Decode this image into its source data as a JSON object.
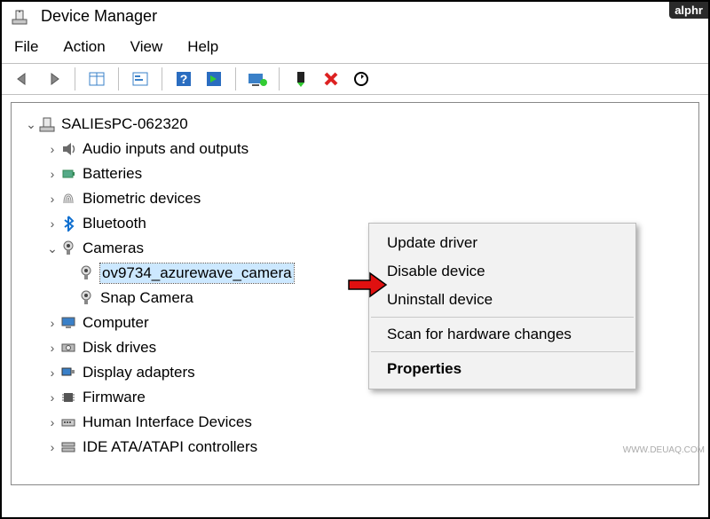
{
  "badge": "alphr",
  "watermark": "WWW.DEUAQ.COM",
  "title": "Device Manager",
  "menu": {
    "file": "File",
    "action": "Action",
    "view": "View",
    "help": "Help"
  },
  "root": "SALIEsPC-062320",
  "nodes": {
    "audio": "Audio inputs and outputs",
    "batteries": "Batteries",
    "biometric": "Biometric devices",
    "bluetooth": "Bluetooth",
    "cameras": "Cameras",
    "cam_sel": "ov9734_azurewave_camera",
    "cam_snap": "Snap Camera",
    "computer": "Computer",
    "disk": "Disk drives",
    "display": "Display adapters",
    "firmware": "Firmware",
    "hid": "Human Interface Devices",
    "ide": "IDE ATA/ATAPI controllers"
  },
  "context": {
    "update": "Update driver",
    "disable": "Disable device",
    "uninstall": "Uninstall device",
    "scan": "Scan for hardware changes",
    "properties": "Properties"
  },
  "icons": {
    "back": "back-arrow-icon",
    "forward": "forward-arrow-icon",
    "detail": "detail-icon",
    "properties": "properties-icon",
    "help": "help-icon",
    "show": "show-icon",
    "monitor": "monitor-icon",
    "install": "install-icon",
    "delete": "delete-icon",
    "scan": "scan-icon"
  }
}
